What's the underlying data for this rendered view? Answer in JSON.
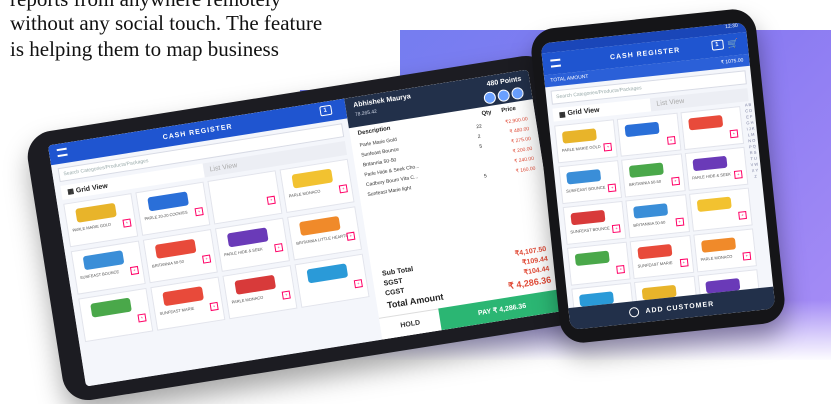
{
  "article": {
    "line1": "reports from anywhere remotely",
    "line2": "without any social touch. The feature",
    "line3": "is helping them to map business"
  },
  "colors": {
    "header_blue": "#1f55d0",
    "customer_bar": "#22304a",
    "pay_green": "#2bb673",
    "price_red": "#e04a36",
    "background_gradient": "#7e85f2"
  },
  "tablet": {
    "header_title": "CASH REGISTER",
    "header_badge": "1",
    "search_placeholder": "Search Categories/Products/Packages",
    "grid_view_label": "Grid View",
    "list_view_label": "List View",
    "customer_name": "Abhishek Maurya",
    "customer_phone": "78.265.42",
    "points": "480 Points",
    "order_header": {
      "desc": "Description",
      "qty": "Qty",
      "price": "Price"
    },
    "order_items": [
      {
        "desc": "Parle Marie Gold",
        "qty": "22",
        "price": "₹2,900.00"
      },
      {
        "desc": "Sunfeast Bounce",
        "qty": "2",
        "price": "₹ 480.00"
      },
      {
        "desc": "Britannia 50-50",
        "qty": "5",
        "price": "₹ 275.00"
      },
      {
        "desc": "Parle Hide & Seek Cho...",
        "qty": "",
        "price": "₹ 200.00"
      },
      {
        "desc": "Cadbury Bourn Vita C...",
        "qty": "",
        "price": "₹ 240.00"
      },
      {
        "desc": "Sunfeast Marie light",
        "qty": "5",
        "price": "₹ 160.00"
      }
    ],
    "subtotal_label": "Sub Total",
    "subtotal_value": "₹4,107.50",
    "sgst_label": "SGST",
    "sgst_value": "₹109.44",
    "cgst_label": "CGST",
    "cgst_value": "₹104.44",
    "total_label": "Total Amount",
    "total_value": "₹ 4,286.36",
    "hold_label": "HOLD",
    "pay_label": "PAY ₹ 4,286.36",
    "products": [
      {
        "name": "PARLE MARIE GOLD",
        "color": "#e8b42a"
      },
      {
        "name": "PARLE 20-20 COOKIES",
        "color": "#2a6fd8"
      },
      {
        "name": "",
        "color": "#ffffff"
      },
      {
        "name": "PARLE MONACO",
        "color": "#f2c230"
      },
      {
        "name": "SUNFEAST BOUNCE",
        "color": "#3a8ed8"
      },
      {
        "name": "BRITANNIA 50-50",
        "color": "#e84a3a"
      },
      {
        "name": "PARLE HIDE & SEEK",
        "color": "#6a3ab8"
      },
      {
        "name": "BRITANNIA LITTLE HEARTS",
        "color": "#f08a2a"
      },
      {
        "name": "",
        "color": "#4aa84a"
      },
      {
        "name": "SUNFEAST MARIE",
        "color": "#e84a3a"
      },
      {
        "name": "PARLE MONACO",
        "color": "#d83a3a"
      },
      {
        "name": "",
        "color": "#2a9ad8"
      }
    ]
  },
  "phone": {
    "status_time": "12:30",
    "header_title": "CASH REGISTER",
    "header_badge": "1",
    "total_amount_label": "TOTAL AMOUNT",
    "total_amount_value": "₹ 1075.00",
    "search_placeholder": "Search Categories/Products/Packages",
    "grid_view_label": "Grid View",
    "list_view_label": "List View",
    "add_customer_label": "ADD CUSTOMER",
    "alphabet": "A B C D E F G H I J K L M N O P Q R S T U V W X Y Z",
    "products": [
      {
        "name": "PARLE MARIE GOLD",
        "color": "#e8b42a"
      },
      {
        "name": "",
        "color": "#2a6fd8"
      },
      {
        "name": "",
        "color": "#e84a3a"
      },
      {
        "name": "SUNFEAST BOUNCE",
        "color": "#3a8ed8"
      },
      {
        "name": "BRITANNIA 50-50",
        "color": "#4aa84a"
      },
      {
        "name": "PARLE HIDE & SEEK",
        "color": "#6a3ab8"
      },
      {
        "name": "SUNFEAST BOUNCE",
        "color": "#d83a3a"
      },
      {
        "name": "BRITANNIA 50-50",
        "color": "#3a8ed8"
      },
      {
        "name": "",
        "color": "#f2c230"
      },
      {
        "name": "",
        "color": "#4aa84a"
      },
      {
        "name": "SUNFEAST MARIE",
        "color": "#e84a3a"
      },
      {
        "name": "PARLE MONACO",
        "color": "#f08a2a"
      },
      {
        "name": "",
        "color": "#2a9ad8"
      },
      {
        "name": "",
        "color": "#e8b42a"
      },
      {
        "name": "",
        "color": "#6a3ab8"
      }
    ]
  }
}
